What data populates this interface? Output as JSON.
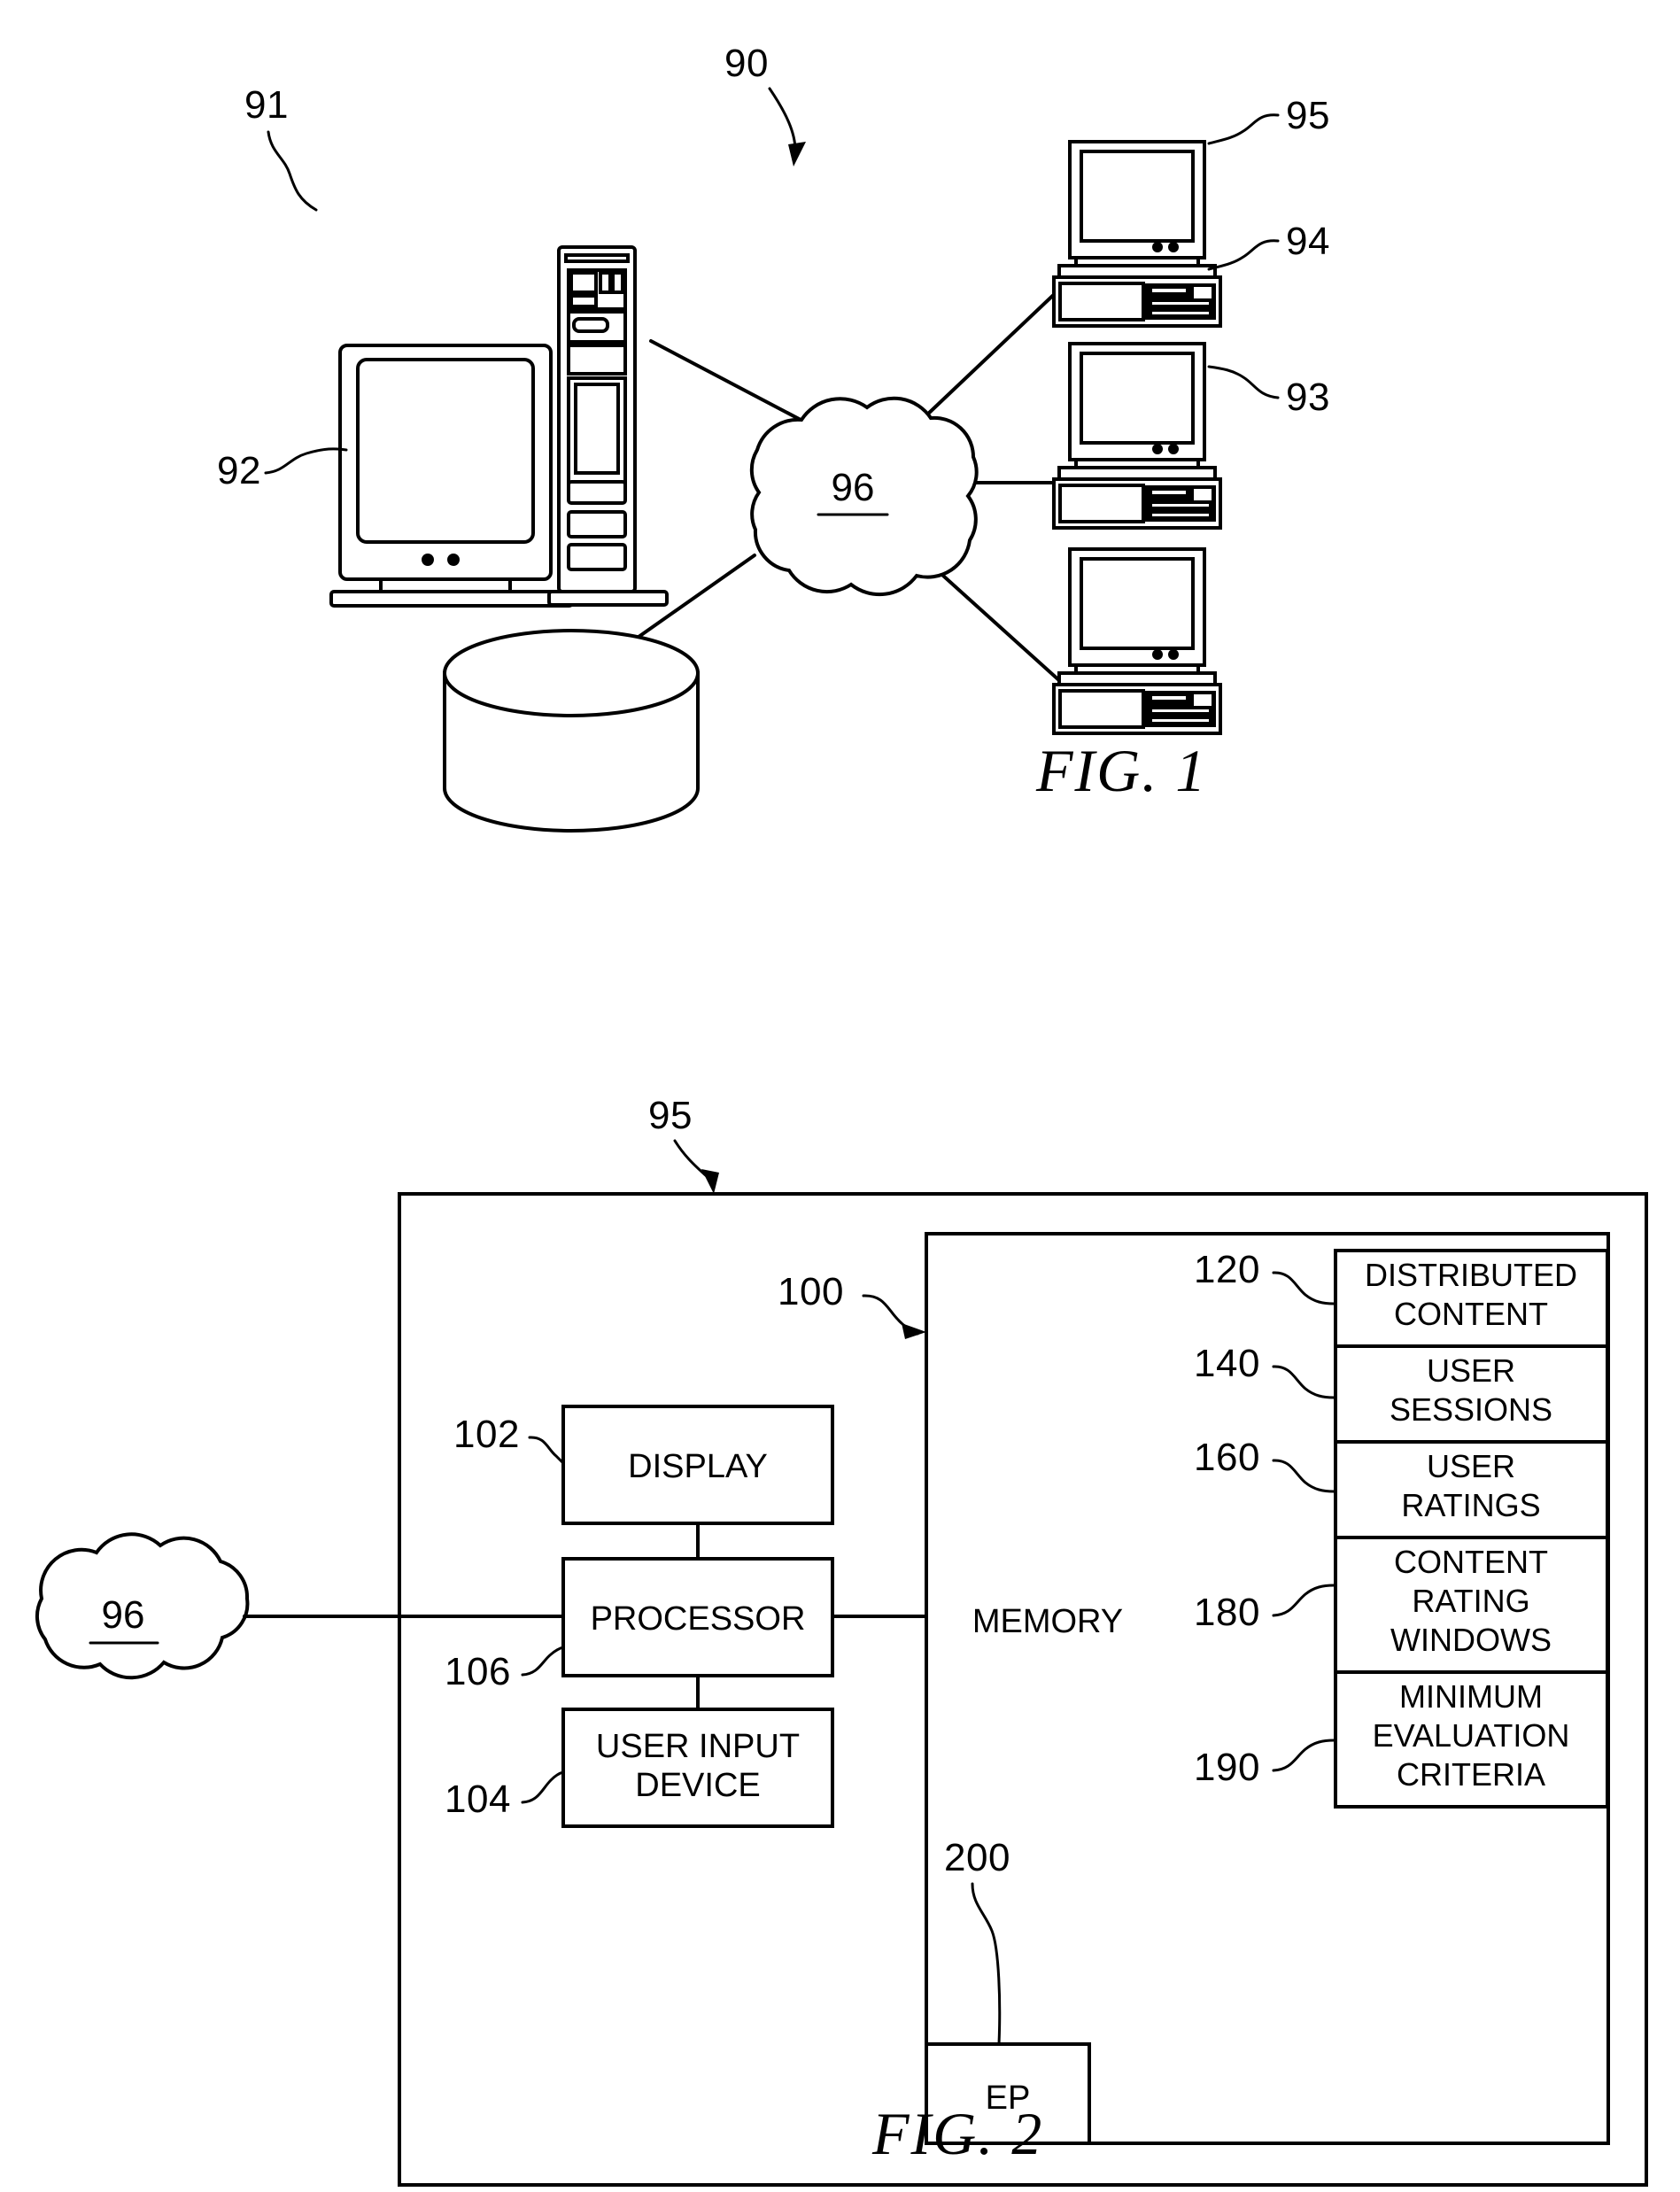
{
  "figure1": {
    "caption": "FIG. 1",
    "system_ref": "90",
    "nodes": [
      {
        "ref": "91",
        "name": "server-workstation",
        "label": ""
      },
      {
        "ref": "92",
        "name": "database-cylinder",
        "label": ""
      },
      {
        "ref": "93",
        "name": "client-computer-93",
        "label": ""
      },
      {
        "ref": "94",
        "name": "client-computer-94",
        "label": ""
      },
      {
        "ref": "95",
        "name": "client-computer-95",
        "label": ""
      },
      {
        "ref": "96",
        "name": "network-cloud",
        "label": "96"
      }
    ],
    "cloud_label": "96"
  },
  "figure2": {
    "caption": "FIG. 2",
    "device_ref": "95",
    "memory_ref": "100",
    "memory_label": "MEMORY",
    "left_blocks": [
      {
        "ref": "102",
        "label": "DISPLAY"
      },
      {
        "ref": "106",
        "label": "PROCESSOR"
      },
      {
        "ref": "104",
        "label": "USER INPUT\nDEVICE",
        "line1": "USER INPUT",
        "line2": "DEVICE"
      }
    ],
    "memory_blocks": [
      {
        "ref": "120",
        "line1": "DISTRIBUTED",
        "line2": "CONTENT",
        "line3": ""
      },
      {
        "ref": "140",
        "line1": "USER",
        "line2": "SESSIONS",
        "line3": ""
      },
      {
        "ref": "160",
        "line1": "USER",
        "line2": "RATINGS",
        "line3": ""
      },
      {
        "ref": "180",
        "line1": "CONTENT",
        "line2": "RATING",
        "line3": "WINDOWS"
      },
      {
        "ref": "190",
        "line1": "MINIMUM",
        "line2": "EVALUATION",
        "line3": "CRITERIA"
      }
    ],
    "ep_block": {
      "ref": "200",
      "label": "EP"
    },
    "cloud_label": "96"
  },
  "colors": {
    "ink": "#000000",
    "paper": "#ffffff"
  }
}
